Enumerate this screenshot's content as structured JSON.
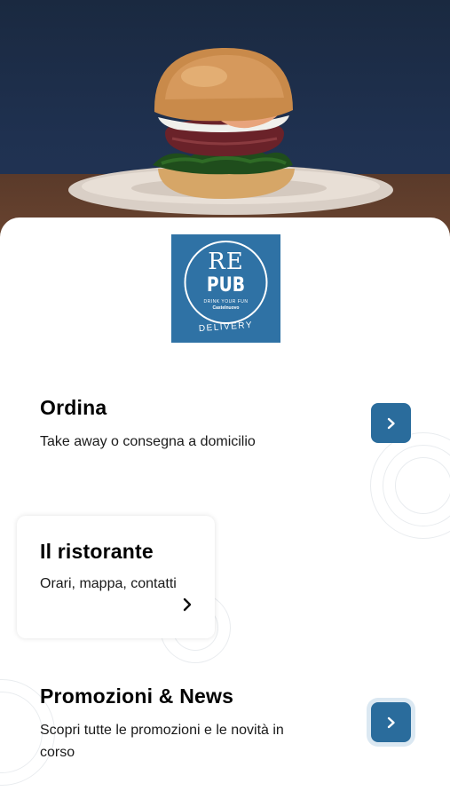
{
  "logo": {
    "line1": "RE",
    "line2": "PUB",
    "tagline": "DRINK YOUR FUN",
    "city": "Castelnuovo",
    "delivery": "DELIVERY"
  },
  "sections": [
    {
      "title": "Ordina",
      "subtitle": "Take away o consegna a domicilio"
    },
    {
      "title": "Il ristorante",
      "subtitle": "Orari, mappa, contatti"
    },
    {
      "title": "Promozioni & News",
      "subtitle_line1": "Scopri tutte le promozioni e le novità in",
      "subtitle_line2": "corso"
    }
  ],
  "colors": {
    "brand": "#2f72a5",
    "button": "#2a6c9c",
    "background": "#ffffff"
  },
  "icons": {
    "arrow": "chevron-right-icon"
  }
}
